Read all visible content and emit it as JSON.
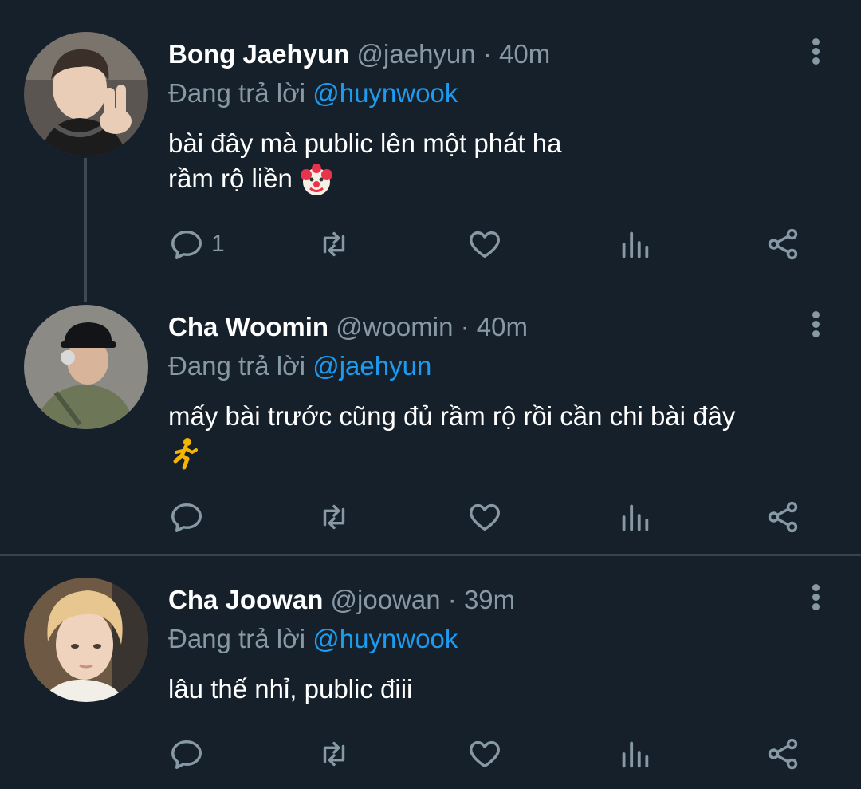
{
  "replying_label": "Đang trả lời",
  "tweets": [
    {
      "name": "Bong Jaehyun",
      "handle": "@jaehyun",
      "sep": "·",
      "time": "40m",
      "reply_to": "@huynwook",
      "text_line1": "bài đây mà public lên một phát ha",
      "text_line2": "rầm rộ liền",
      "emoji": "clown-face-icon",
      "reply_count": "1"
    },
    {
      "name": "Cha Woomin",
      "handle": "@woomin",
      "sep": "·",
      "time": "40m",
      "reply_to": "@jaehyun",
      "text_line1": "mấy bài trước cũng đủ rầm rộ rồi cần chi bài đây",
      "emoji": "person-running-icon",
      "reply_count": ""
    },
    {
      "name": "Cha Joowan",
      "handle": "@joowan",
      "sep": "·",
      "time": "39m",
      "reply_to": "@huynwook",
      "text_line1": "lâu thế nhỉ, public điii",
      "reply_count": ""
    }
  ],
  "colors": {
    "background": "#15202b",
    "name": "#ffffff",
    "muted": "#8899a6",
    "mention": "#1d9bf0"
  }
}
